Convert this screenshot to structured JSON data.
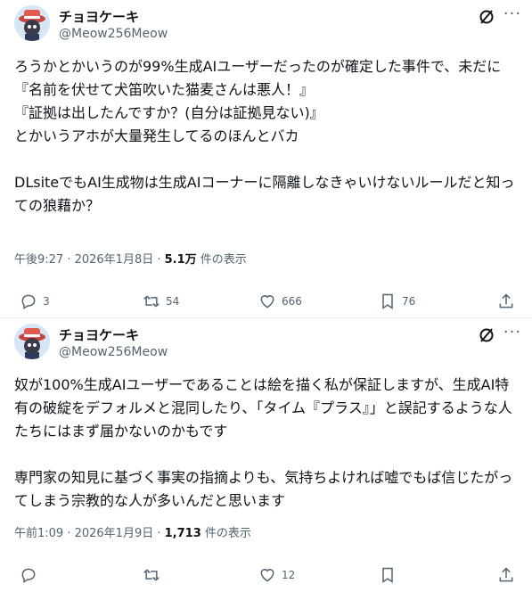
{
  "tweets": [
    {
      "display_name": "チョヨケーキ",
      "handle": "@Meow256Meow",
      "text": "ろうかとかいうのが99%生成AIユーザーだったのが確定した事件で、未だに\n『名前を伏せて犬笛吹いた猫麦さんは悪人！』\n『証拠は出したんですか？(自分は証拠見ない)』\nとかいうアホが大量発生してるのほんとバカ\n\nDLsiteでもAI生成物は生成AIコーナーに隔離しなきゃいけないルールだと知っての狼藉か？",
      "time": "午後9:27 · 2026年1月8日 · ",
      "views_count": "5.1万",
      "views_label": " 件の表示",
      "replies": "3",
      "reposts": "54",
      "likes": "666",
      "bookmarks": "76"
    },
    {
      "display_name": "チョヨケーキ",
      "handle": "@Meow256Meow",
      "text": "奴が100%生成AIユーザーであることは絵を描く私が保証しますが、生成AI特有の破綻をデフォルメと混同したり、「タイム『プラス』」と誤記するような人たちにはまず届かないのかもです\n\n専門家の知見に基づく事実の指摘よりも、気持ちよければ嘘でもば信じたがってしまう宗教的な人が多いんだと思います",
      "time": "午前1:09 · 2026年1月9日 · ",
      "views_count": "1,713",
      "views_label": " 件の表示",
      "replies": "",
      "reposts": "",
      "likes": "12",
      "bookmarks": ""
    }
  ],
  "icons": [
    "avatar",
    "grok-icon",
    "more-icon",
    "reply-icon",
    "repost-icon",
    "like-icon",
    "bookmark-icon",
    "share-icon"
  ]
}
